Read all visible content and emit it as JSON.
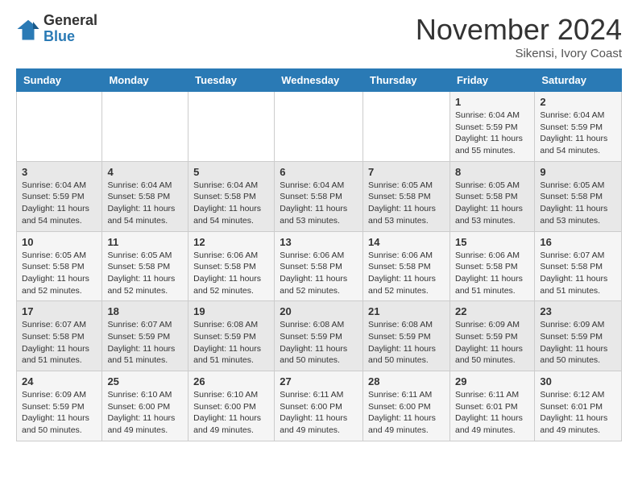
{
  "logo": {
    "general": "General",
    "blue": "Blue"
  },
  "header": {
    "month": "November 2024",
    "location": "Sikensi, Ivory Coast"
  },
  "weekdays": [
    "Sunday",
    "Monday",
    "Tuesday",
    "Wednesday",
    "Thursday",
    "Friday",
    "Saturday"
  ],
  "rows": [
    [
      {
        "day": "",
        "info": ""
      },
      {
        "day": "",
        "info": ""
      },
      {
        "day": "",
        "info": ""
      },
      {
        "day": "",
        "info": ""
      },
      {
        "day": "",
        "info": ""
      },
      {
        "day": "1",
        "info": "Sunrise: 6:04 AM\nSunset: 5:59 PM\nDaylight: 11 hours and 55 minutes."
      },
      {
        "day": "2",
        "info": "Sunrise: 6:04 AM\nSunset: 5:59 PM\nDaylight: 11 hours and 54 minutes."
      }
    ],
    [
      {
        "day": "3",
        "info": "Sunrise: 6:04 AM\nSunset: 5:59 PM\nDaylight: 11 hours and 54 minutes."
      },
      {
        "day": "4",
        "info": "Sunrise: 6:04 AM\nSunset: 5:58 PM\nDaylight: 11 hours and 54 minutes."
      },
      {
        "day": "5",
        "info": "Sunrise: 6:04 AM\nSunset: 5:58 PM\nDaylight: 11 hours and 54 minutes."
      },
      {
        "day": "6",
        "info": "Sunrise: 6:04 AM\nSunset: 5:58 PM\nDaylight: 11 hours and 53 minutes."
      },
      {
        "day": "7",
        "info": "Sunrise: 6:05 AM\nSunset: 5:58 PM\nDaylight: 11 hours and 53 minutes."
      },
      {
        "day": "8",
        "info": "Sunrise: 6:05 AM\nSunset: 5:58 PM\nDaylight: 11 hours and 53 minutes."
      },
      {
        "day": "9",
        "info": "Sunrise: 6:05 AM\nSunset: 5:58 PM\nDaylight: 11 hours and 53 minutes."
      }
    ],
    [
      {
        "day": "10",
        "info": "Sunrise: 6:05 AM\nSunset: 5:58 PM\nDaylight: 11 hours and 52 minutes."
      },
      {
        "day": "11",
        "info": "Sunrise: 6:05 AM\nSunset: 5:58 PM\nDaylight: 11 hours and 52 minutes."
      },
      {
        "day": "12",
        "info": "Sunrise: 6:06 AM\nSunset: 5:58 PM\nDaylight: 11 hours and 52 minutes."
      },
      {
        "day": "13",
        "info": "Sunrise: 6:06 AM\nSunset: 5:58 PM\nDaylight: 11 hours and 52 minutes."
      },
      {
        "day": "14",
        "info": "Sunrise: 6:06 AM\nSunset: 5:58 PM\nDaylight: 11 hours and 52 minutes."
      },
      {
        "day": "15",
        "info": "Sunrise: 6:06 AM\nSunset: 5:58 PM\nDaylight: 11 hours and 51 minutes."
      },
      {
        "day": "16",
        "info": "Sunrise: 6:07 AM\nSunset: 5:58 PM\nDaylight: 11 hours and 51 minutes."
      }
    ],
    [
      {
        "day": "17",
        "info": "Sunrise: 6:07 AM\nSunset: 5:58 PM\nDaylight: 11 hours and 51 minutes."
      },
      {
        "day": "18",
        "info": "Sunrise: 6:07 AM\nSunset: 5:59 PM\nDaylight: 11 hours and 51 minutes."
      },
      {
        "day": "19",
        "info": "Sunrise: 6:08 AM\nSunset: 5:59 PM\nDaylight: 11 hours and 51 minutes."
      },
      {
        "day": "20",
        "info": "Sunrise: 6:08 AM\nSunset: 5:59 PM\nDaylight: 11 hours and 50 minutes."
      },
      {
        "day": "21",
        "info": "Sunrise: 6:08 AM\nSunset: 5:59 PM\nDaylight: 11 hours and 50 minutes."
      },
      {
        "day": "22",
        "info": "Sunrise: 6:09 AM\nSunset: 5:59 PM\nDaylight: 11 hours and 50 minutes."
      },
      {
        "day": "23",
        "info": "Sunrise: 6:09 AM\nSunset: 5:59 PM\nDaylight: 11 hours and 50 minutes."
      }
    ],
    [
      {
        "day": "24",
        "info": "Sunrise: 6:09 AM\nSunset: 5:59 PM\nDaylight: 11 hours and 50 minutes."
      },
      {
        "day": "25",
        "info": "Sunrise: 6:10 AM\nSunset: 6:00 PM\nDaylight: 11 hours and 49 minutes."
      },
      {
        "day": "26",
        "info": "Sunrise: 6:10 AM\nSunset: 6:00 PM\nDaylight: 11 hours and 49 minutes."
      },
      {
        "day": "27",
        "info": "Sunrise: 6:11 AM\nSunset: 6:00 PM\nDaylight: 11 hours and 49 minutes."
      },
      {
        "day": "28",
        "info": "Sunrise: 6:11 AM\nSunset: 6:00 PM\nDaylight: 11 hours and 49 minutes."
      },
      {
        "day": "29",
        "info": "Sunrise: 6:11 AM\nSunset: 6:01 PM\nDaylight: 11 hours and 49 minutes."
      },
      {
        "day": "30",
        "info": "Sunrise: 6:12 AM\nSunset: 6:01 PM\nDaylight: 11 hours and 49 minutes."
      }
    ]
  ]
}
